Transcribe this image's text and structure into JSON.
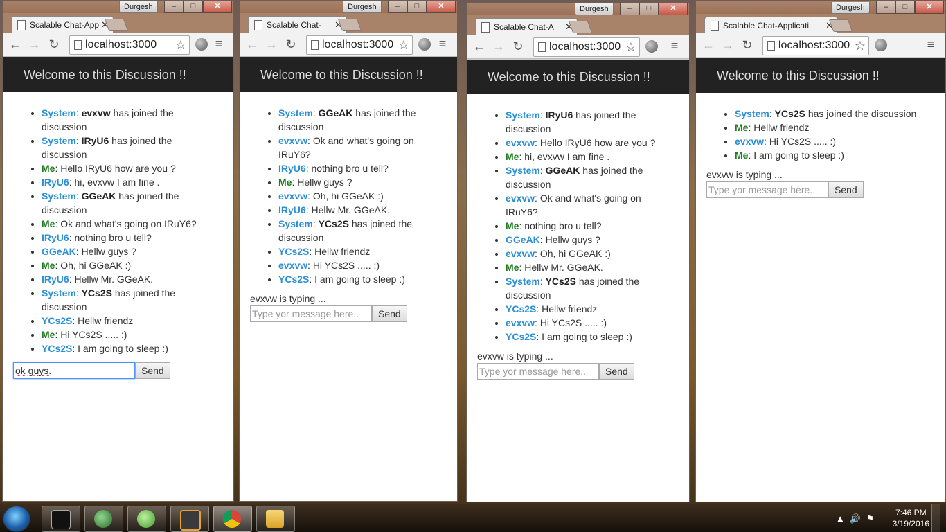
{
  "windows": [
    {
      "user": "Durgesh",
      "tab_title": "Scalable Chat-App",
      "url": "localhost:3000",
      "header": "Welcome to this Discussion !!",
      "messages": [
        {
          "who": "System",
          "text": ": ",
          "bold": "evxvw",
          "rest": " has joined the discussion"
        },
        {
          "who": "System",
          "text": ": ",
          "bold": "IRyU6",
          "rest": " has joined the discussion"
        },
        {
          "who": "Me",
          "text": ": Hello IRyU6 how are you ?"
        },
        {
          "who": "IRyU6",
          "text": ": hi, evxvw I am fine ."
        },
        {
          "who": "System",
          "text": ": ",
          "bold": "GGeAK",
          "rest": " has joined the discussion"
        },
        {
          "who": "Me",
          "text": ": Ok and what's going on IRuY6?"
        },
        {
          "who": "IRyU6",
          "text": ": nothing bro u tell?"
        },
        {
          "who": "GGeAK",
          "text": ": Hellw guys ?"
        },
        {
          "who": "Me",
          "text": ": Oh, hi GGeAK :)"
        },
        {
          "who": "IRyU6",
          "text": ": Hellw Mr. GGeAK."
        },
        {
          "who": "System",
          "text": ": ",
          "bold": "YCs2S",
          "rest": " has joined the discussion"
        },
        {
          "who": "YCs2S",
          "text": ": Hellw friendz"
        },
        {
          "who": "Me",
          "text": ": Hi YCs2S ..... :)"
        },
        {
          "who": "YCs2S",
          "text": ": I am going to sleep :)"
        }
      ],
      "typing": "",
      "input_value": "ok guys.",
      "placeholder": "Type yor message here..",
      "send": "Send"
    },
    {
      "user": "Durgesh",
      "tab_title": "Scalable Chat-",
      "url": "localhost:3000",
      "header": "Welcome to this Discussion !!",
      "messages": [
        {
          "who": "System",
          "text": ": ",
          "bold": "GGeAK",
          "rest": " has joined the discussion"
        },
        {
          "who": "evxvw",
          "text": ": Ok and what's going on IRuY6?"
        },
        {
          "who": "IRyU6",
          "text": ": nothing bro u tell?"
        },
        {
          "who": "Me",
          "text": ": Hellw guys ?"
        },
        {
          "who": "evxvw",
          "text": ": Oh, hi GGeAK :)"
        },
        {
          "who": "IRyU6",
          "text": ": Hellw Mr. GGeAK."
        },
        {
          "who": "System",
          "text": ": ",
          "bold": "YCs2S",
          "rest": " has joined the discussion"
        },
        {
          "who": "YCs2S",
          "text": ": Hellw friendz"
        },
        {
          "who": "evxvw",
          "text": ": Hi YCs2S ..... :)"
        },
        {
          "who": "YCs2S",
          "text": ": I am going to sleep :)"
        }
      ],
      "typing": "evxvw is typing ...",
      "input_value": "",
      "placeholder": "Type yor message here..",
      "send": "Send"
    },
    {
      "user": "Durgesh",
      "tab_title": "Scalable Chat-A",
      "url": "localhost:3000",
      "header": "Welcome to this Discussion !!",
      "messages": [
        {
          "who": "System",
          "text": ": ",
          "bold": "IRyU6",
          "rest": " has joined the discussion"
        },
        {
          "who": "evxvw",
          "text": ": Hello IRyU6 how are you ?"
        },
        {
          "who": "Me",
          "text": ": hi, evxvw I am fine ."
        },
        {
          "who": "System",
          "text": ": ",
          "bold": "GGeAK",
          "rest": " has joined the discussion"
        },
        {
          "who": "evxvw",
          "text": ": Ok and what's going on IRuY6?"
        },
        {
          "who": "Me",
          "text": ": nothing bro u tell?"
        },
        {
          "who": "GGeAK",
          "text": ": Hellw guys ?"
        },
        {
          "who": "evxvw",
          "text": ": Oh, hi GGeAK :)"
        },
        {
          "who": "Me",
          "text": ": Hellw Mr. GGeAK."
        },
        {
          "who": "System",
          "text": ": ",
          "bold": "YCs2S",
          "rest": " has joined the discussion"
        },
        {
          "who": "YCs2S",
          "text": ": Hellw friendz"
        },
        {
          "who": "evxvw",
          "text": ": Hi YCs2S ..... :)"
        },
        {
          "who": "YCs2S",
          "text": ": I am going to sleep :)"
        }
      ],
      "typing": "evxvw is typing ...",
      "input_value": "",
      "placeholder": "Type yor message here..",
      "send": "Send"
    },
    {
      "user": "Durgesh",
      "tab_title": "Scalable Chat-Applicati",
      "url": "localhost:3000",
      "header": "Welcome to this Discussion !!",
      "messages": [
        {
          "who": "System",
          "text": ": ",
          "bold": "YCs2S",
          "rest": " has joined the discussion"
        },
        {
          "who": "Me",
          "text": ": Hellw friendz"
        },
        {
          "who": "evxvw",
          "text": ": Hi YCs2S ..... :)"
        },
        {
          "who": "Me",
          "text": ": I am going to sleep :)"
        }
      ],
      "typing": "evxvw is typing ...",
      "input_value": "",
      "placeholder": "Type yor message here..",
      "send": "Send"
    }
  ],
  "taskbar": {
    "time": "7:46 PM",
    "date": "3/19/2016",
    "items": [
      "cmd-icon",
      "globe-icon",
      "utorrent-icon",
      "sublime-icon",
      "chrome-icon",
      "explorer-icon"
    ]
  },
  "colors": {
    "username": "#2a8fd6",
    "me": "#1e7d1e",
    "header_bg": "#222222"
  }
}
